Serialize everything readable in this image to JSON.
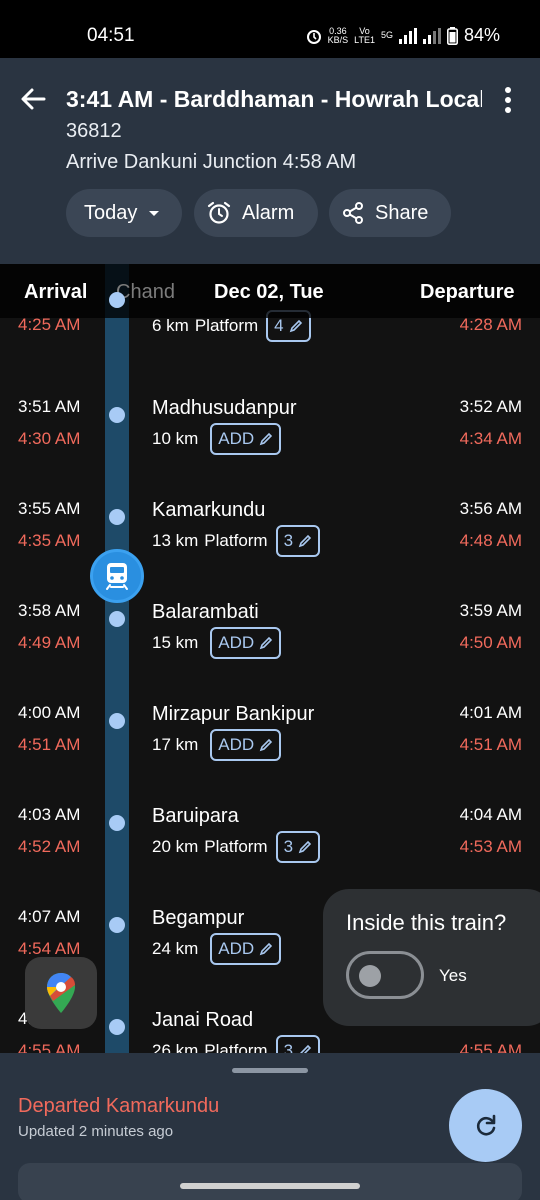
{
  "status_bar": {
    "time": "04:51",
    "net_speed_top": "0.36",
    "net_speed_bottom": "KB/S",
    "volte_top": "Vo",
    "volte_bottom": "LTE1",
    "network": "5G",
    "battery": "84%"
  },
  "header": {
    "title": "3:41 AM - Barddhaman - Howrah Local",
    "train_number": "36812",
    "arrival_info": "Arrive Dankuni Junction 4:58 AM",
    "chips": {
      "today": "Today",
      "alarm": "Alarm",
      "share": "Share"
    }
  },
  "column_header": {
    "arrival": "Arrival",
    "date": "Dec 02, Tue",
    "departure": "Departure",
    "partial_station": "Chand"
  },
  "stations": [
    {
      "name": "",
      "distance": "6 km",
      "platform_label": "Platform",
      "platform": "4",
      "arr_sched": "",
      "arr_actual": "4:25 AM",
      "dep_sched": "",
      "dep_actual": "4:28 AM"
    },
    {
      "name": "Madhusudanpur",
      "distance": "10 km",
      "platform_label": "",
      "platform": "ADD",
      "arr_sched": "3:51 AM",
      "arr_actual": "4:30 AM",
      "dep_sched": "3:52 AM",
      "dep_actual": "4:34 AM"
    },
    {
      "name": "Kamarkundu",
      "distance": "13 km",
      "platform_label": "Platform",
      "platform": "3",
      "arr_sched": "3:55 AM",
      "arr_actual": "4:35 AM",
      "dep_sched": "3:56 AM",
      "dep_actual": "4:48 AM"
    },
    {
      "name": "Balarambati",
      "distance": "15 km",
      "platform_label": "",
      "platform": "ADD",
      "arr_sched": "3:58 AM",
      "arr_actual": "4:49 AM",
      "dep_sched": "3:59 AM",
      "dep_actual": "4:50 AM"
    },
    {
      "name": "Mirzapur Bankipur",
      "distance": "17 km",
      "platform_label": "",
      "platform": "ADD",
      "arr_sched": "4:00 AM",
      "arr_actual": "4:51 AM",
      "dep_sched": "4:01 AM",
      "dep_actual": "4:51 AM"
    },
    {
      "name": "Baruipara",
      "distance": "20 km",
      "platform_label": "Platform",
      "platform": "3",
      "arr_sched": "4:03 AM",
      "arr_actual": "4:52 AM",
      "dep_sched": "4:04 AM",
      "dep_actual": "4:53 AM"
    },
    {
      "name": "Begampur",
      "distance": "24 km",
      "platform_label": "",
      "platform": "ADD",
      "arr_sched": "4:07 AM",
      "arr_actual": "4:54 AM",
      "dep_sched": "",
      "dep_actual": ""
    },
    {
      "name": "Janai Road",
      "distance": "26 km",
      "platform_label": "Platform",
      "platform": "3",
      "arr_sched": "4:",
      "arr_actual": "4:55 AM",
      "dep_sched": "",
      "dep_actual": "4:55 AM"
    }
  ],
  "inside_train": {
    "title": "Inside this train?",
    "toggle_label": "Yes"
  },
  "bottom_sheet": {
    "status": "Departed Kamarkundu",
    "updated": "Updated 2 minutes ago"
  },
  "colors": {
    "header_bg": "#2a3441",
    "late_red": "#f16a5c",
    "track_blue": "#1e4a68",
    "accent_blue": "#a8cbf5"
  },
  "icons": [
    "back-arrow-icon",
    "kebab-menu-icon",
    "dropdown-icon",
    "alarm-icon",
    "share-icon",
    "edit-pencil-icon",
    "train-icon",
    "google-maps-icon",
    "refresh-icon"
  ]
}
